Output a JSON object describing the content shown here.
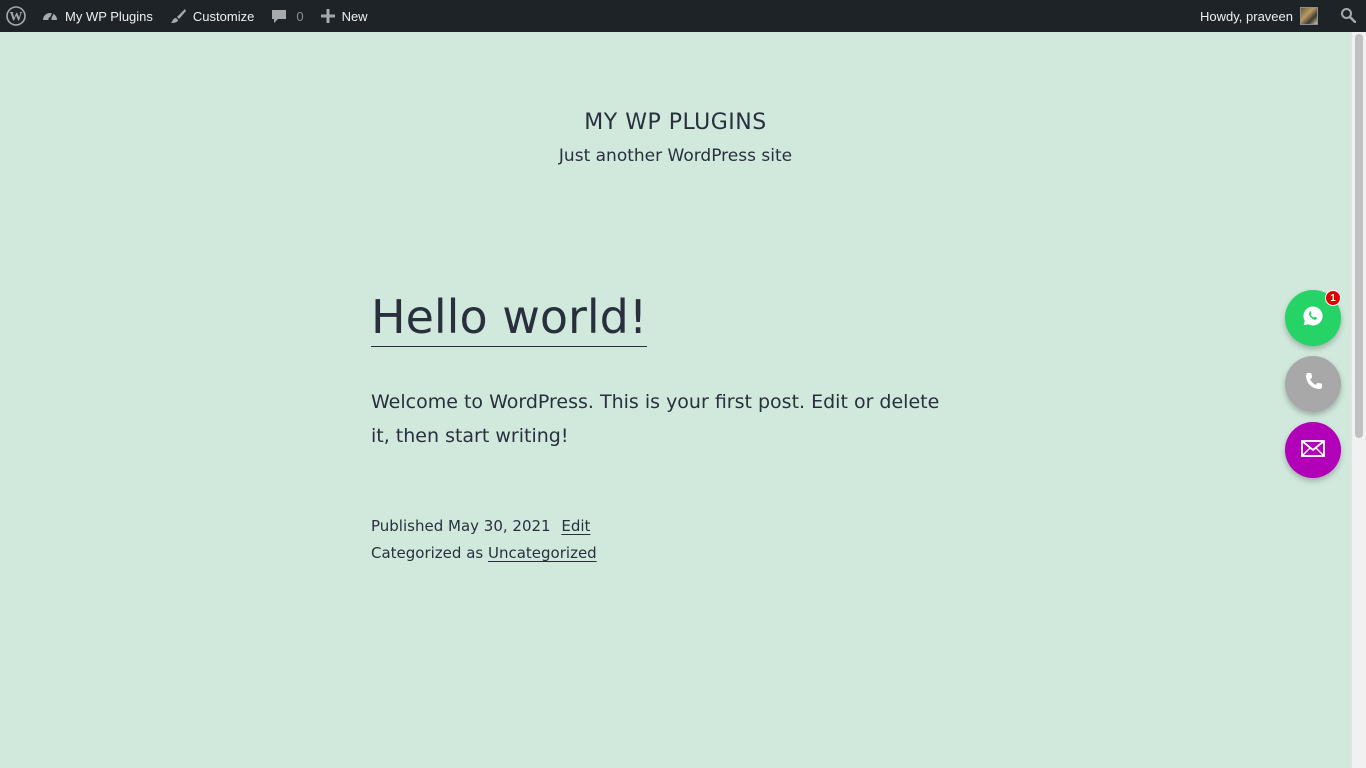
{
  "adminbar": {
    "wp_logo_icon": "wordpress-logo-icon",
    "site_name": "My WP Plugins",
    "customize_label": "Customize",
    "comments_count": "0",
    "new_label": "New",
    "greeting": "Howdy, praveen",
    "colors": {
      "background": "#1d2327",
      "text": "#f0f0f1"
    }
  },
  "site": {
    "title": "MY WP PLUGINS",
    "description": "Just another WordPress site"
  },
  "post": {
    "title": "Hello world!",
    "content": "Welcome to WordPress. This is your first post. Edit or delete it, then start writing!",
    "published_label": "Published",
    "published_date": "May 30, 2021",
    "edit_label": "Edit",
    "category_label": "Categorized as",
    "category": "Uncategorized"
  },
  "floating_buttons": {
    "whatsapp_badge": "1",
    "colors": {
      "whatsapp": "#25d366",
      "phone": "#a8a8a8",
      "email": "#b100b8"
    }
  },
  "theme": {
    "background": "#d1e9dd",
    "text": "#28303d"
  }
}
